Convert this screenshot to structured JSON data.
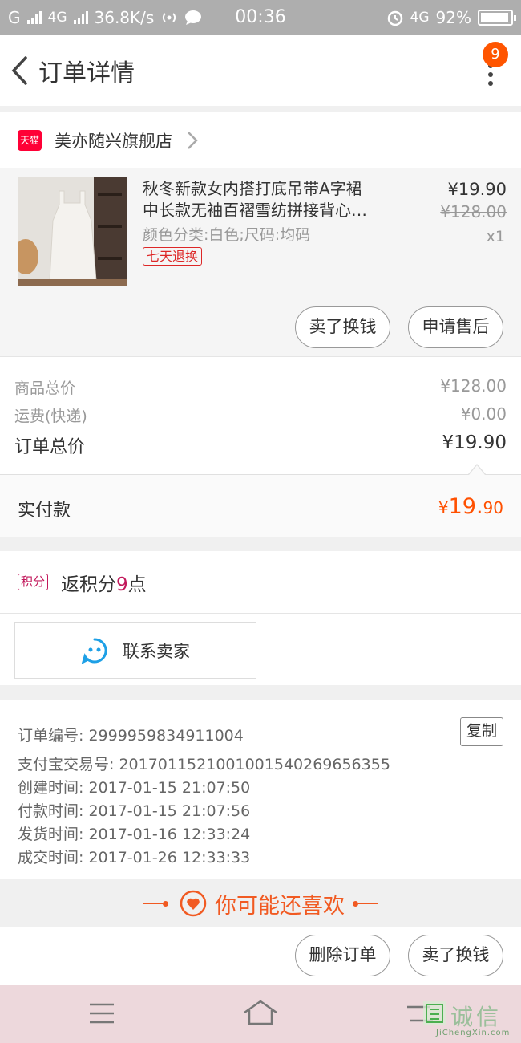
{
  "status_bar": {
    "carrier": "G",
    "network": "4G",
    "speed": "36.8K/s",
    "time": "00:36",
    "network2": "4G",
    "battery": "92%"
  },
  "header": {
    "title": "订单详情",
    "badge_count": "9"
  },
  "store": {
    "tmall_label": "天猫",
    "name": "美亦随兴旗舰店"
  },
  "product": {
    "title_line1": "秋冬新款女内搭打底吊带A字裙",
    "title_line2": "中长款无袖百褶雪纺拼接背心…",
    "spec": "颜色分类:白色;尺码:均码",
    "tag": "七天退换",
    "price": "¥19.90",
    "original_price": "¥128.00",
    "quantity": "x1",
    "sell_button": "卖了换钱",
    "aftersale_button": "申请售后"
  },
  "totals": {
    "goods_label": "商品总价",
    "goods_value": "¥128.00",
    "shipping_label": "运费(快递)",
    "shipping_value": "¥0.00",
    "order_label": "订单总价",
    "order_value": "¥19.90",
    "paid_label": "实付款",
    "paid_currency": "¥",
    "paid_int": "19.",
    "paid_dec": "90"
  },
  "points": {
    "badge": "积分",
    "prefix": "返积分",
    "number": "9",
    "suffix": "点"
  },
  "contact": {
    "label": "联系卖家"
  },
  "order_info": {
    "order_no": "订单编号: 2999959834911004",
    "copy_label": "复制",
    "alipay_no": "支付宝交易号: 2017011521001001540269656355",
    "created": "创建时间: 2017-01-15 21:07:50",
    "paid": "付款时间: 2017-01-15 21:07:56",
    "shipped": "发货时间: 2017-01-16 12:33:24",
    "completed": "成交时间: 2017-01-26 12:33:33"
  },
  "recommend": {
    "title": "你可能还喜欢"
  },
  "actions": {
    "delete_label": "删除订单",
    "sell_label": "卖了换钱"
  },
  "watermark": {
    "text": "诚信",
    "url_text": "JiChengXin.com"
  },
  "colors": {
    "accent": "#ff5000",
    "tmall": "#ff0036",
    "points": "#c2185b",
    "recommend": "#f15a22"
  }
}
